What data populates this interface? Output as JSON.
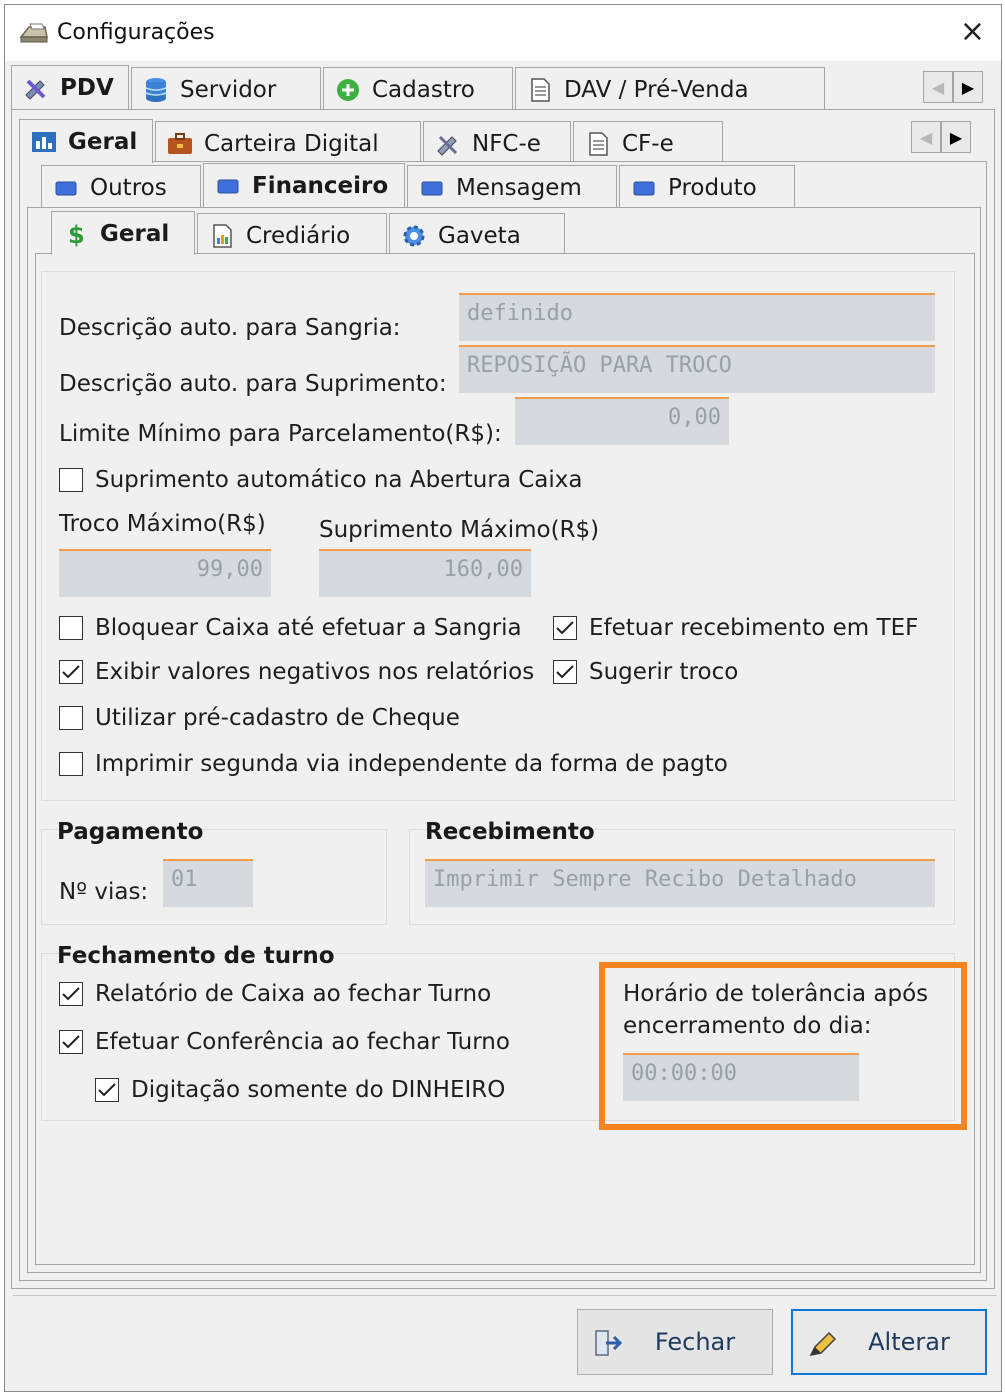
{
  "window": {
    "title": "Configurações",
    "close_label": "×"
  },
  "tabs_level1": [
    {
      "label": "PDV",
      "icon": "pdv-tools-icon",
      "active": true
    },
    {
      "label": "Servidor",
      "icon": "database-icon"
    },
    {
      "label": "Cadastro",
      "icon": "add-circle-icon"
    },
    {
      "label": "DAV / Pré-Venda",
      "icon": "document-icon"
    }
  ],
  "tabs_level2": [
    {
      "label": "Geral",
      "icon": "chart-icon",
      "active": true
    },
    {
      "label": "Carteira Digital",
      "icon": "briefcase-icon"
    },
    {
      "label": "NFC-e",
      "icon": "nfce-icon"
    },
    {
      "label": "CF-e",
      "icon": "document-icon"
    }
  ],
  "tabs_level3": [
    {
      "label": "Outros",
      "icon": "folder-icon"
    },
    {
      "label": "Financeiro",
      "icon": "folder-icon",
      "active": true
    },
    {
      "label": "Mensagem",
      "icon": "folder-icon"
    },
    {
      "label": "Produto",
      "icon": "folder-icon"
    }
  ],
  "tabs_level4": [
    {
      "label": "Geral",
      "icon": "dollar-icon",
      "active": true
    },
    {
      "label": "Crediário",
      "icon": "report-icon"
    },
    {
      "label": "Gaveta",
      "icon": "gear-icon"
    }
  ],
  "scroll": {
    "left": "◀",
    "right": "▶"
  },
  "form": {
    "sangria_label": "Descrição auto. para Sangria:",
    "sangria_value": "definido",
    "suprimento_label": "Descrição auto. para Suprimento:",
    "suprimento_value": "REPOSIÇÃO PARA TROCO",
    "limite_label": "Limite Mínimo para Parcelamento(R$):",
    "limite_value": "0,00",
    "suprimento_auto_label": "Suprimento automático na Abertura Caixa",
    "troco_max_label": "Troco Máximo(R$)",
    "troco_max_value": "99,00",
    "suprimento_max_label": "Suprimento Máximo(R$)",
    "suprimento_max_value": "160,00",
    "checks": {
      "bloquear": {
        "label": "Bloquear Caixa até efetuar a Sangria",
        "checked": false
      },
      "efetuar_tef": {
        "label": "Efetuar recebimento em TEF",
        "checked": true
      },
      "exibir_negativos": {
        "label": "Exibir valores negativos nos relatórios",
        "checked": true
      },
      "sugerir_troco": {
        "label": "Sugerir troco",
        "checked": true
      },
      "pre_cadastro": {
        "label": "Utilizar pré-cadastro de Cheque",
        "checked": false
      },
      "segunda_via": {
        "label": "Imprimir segunda via independente da forma de pagto",
        "checked": false
      }
    }
  },
  "pagamento": {
    "title": "Pagamento",
    "vias_label": "Nº vias:",
    "vias_value": "01"
  },
  "recebimento": {
    "title": "Recebimento",
    "value": "Imprimir Sempre Recibo Detalhado"
  },
  "fechamento": {
    "title": "Fechamento de turno",
    "relatorio": {
      "label": "Relatório de Caixa ao fechar Turno",
      "checked": true
    },
    "conferencia": {
      "label": "Efetuar Conferência ao fechar Turno",
      "checked": true
    },
    "digitacao": {
      "label": "Digitação somente do DINHEIRO",
      "checked": true
    },
    "tolerancia_label_1": "Horário de tolerância após",
    "tolerancia_label_2": "encerramento do dia:",
    "tolerancia_value": "00:00:00"
  },
  "buttons": {
    "fechar": "Fechar",
    "alterar": "Alterar"
  },
  "colors": {
    "accent": "#f5831f",
    "field_bg": "#d6dade",
    "field_top": "#f39c4a",
    "primary_border": "#0a78d4"
  }
}
